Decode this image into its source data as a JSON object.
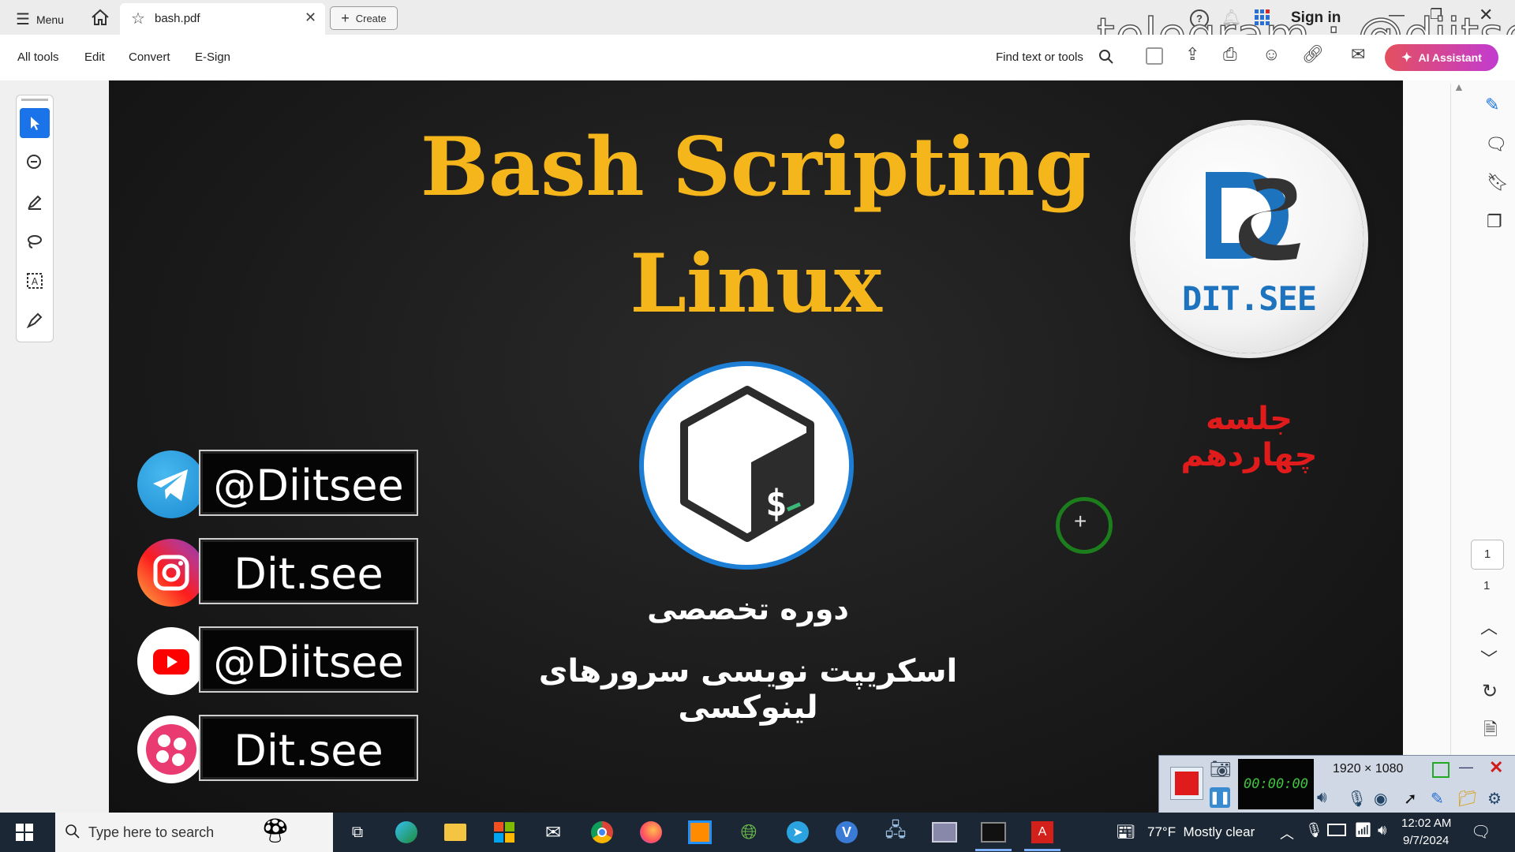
{
  "tabbar": {
    "menu_label": "Menu",
    "doc_tab_title": "bash.pdf",
    "create_label": "Create",
    "sign_in_label": "Sign in",
    "watermark": "telegram : @diitsee"
  },
  "toolbar": {
    "menu": [
      "All tools",
      "Edit",
      "Convert",
      "E-Sign"
    ],
    "find_label": "Find text or tools",
    "ai_label": "AI Assistant"
  },
  "slide": {
    "title_line1": "Bash Scripting",
    "title_line2": "Linux",
    "logo_text": "DIT.SEE",
    "session_text": "جلسه چهاردهم",
    "course_line1": "دوره تخصصی",
    "course_line2": "اسکریپت نویسی سرورهای لینوکسی",
    "socials": [
      {
        "platform": "telegram-icon",
        "handle": "@Diitsee",
        "color": "#2aa3e0"
      },
      {
        "platform": "instagram-icon",
        "handle": "Dit.see",
        "color": "#e1306c"
      },
      {
        "platform": "youtube-icon",
        "handle": "@Diitsee",
        "color": "#ff0000"
      },
      {
        "platform": "aparat-icon",
        "handle": "Dit.see",
        "color": "#ea3a72"
      }
    ],
    "prompt_symbol": "$_"
  },
  "page_nav": {
    "current_page": "1",
    "total_pages": "1"
  },
  "recorder": {
    "resolution": "1920 × 1080",
    "timer": "00:00:00"
  },
  "taskbar": {
    "search_placeholder": "Type here to search",
    "weather": "77°F  Mostly clear",
    "time": "12:02 AM",
    "date": "9/7/2024"
  },
  "colors": {
    "title_gold": "#f5b61c",
    "session_red": "#e01b1b",
    "tool_active": "#1a73e8",
    "taskbar_bg": "#1b2735"
  }
}
